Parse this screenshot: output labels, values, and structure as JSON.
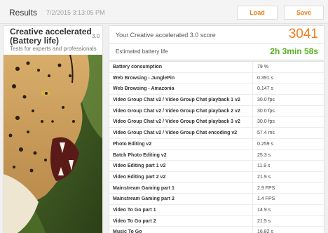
{
  "header": {
    "title": "Results",
    "date": "7/2/2015 3:13:05 PM",
    "load_label": "Load",
    "save_label": "Save"
  },
  "test": {
    "title": "Creative accelerated (Battery life)",
    "version": "3.0",
    "subtitle": "Tests for experts and professionals"
  },
  "score": {
    "label": "Your Creative accelerated 3.0 score",
    "value": "3041"
  },
  "battery": {
    "label": "Estimated battery life",
    "value": "2h 3min 58s"
  },
  "colors": {
    "accent": "#f07c1c",
    "battery_green": "#58b21e"
  },
  "rows": [
    {
      "name": "Battery consumption",
      "value": "79 %"
    },
    {
      "name": "Web Browsing - JunglePin",
      "value": "0.391 s"
    },
    {
      "name": "Web Browsing - Amazonia",
      "value": "0.147 s"
    },
    {
      "name": "Video Group Chat v2 / Video Group Chat playback 1 v2",
      "value": "30.0 fps"
    },
    {
      "name": "Video Group Chat v2 / Video Group Chat playback 2 v2",
      "value": "30.0 fps"
    },
    {
      "name": "Video Group Chat v2 / Video Group Chat playback 3 v2",
      "value": "30.0 fps"
    },
    {
      "name": "Video Group Chat v2 / Video Group Chat encoding v2",
      "value": "57.4 ms"
    },
    {
      "name": "Photo Editing v2",
      "value": "0.259 s"
    },
    {
      "name": "Batch Photo Editing v2",
      "value": "25.3 s"
    },
    {
      "name": "Video Editing part 1 v2",
      "value": "11.9 s"
    },
    {
      "name": "Video Editing part 2 v2",
      "value": "21.9 s"
    },
    {
      "name": "Mainstream Gaming part 1",
      "value": "2.9 FPS"
    },
    {
      "name": "Mainstream Gaming part 2",
      "value": "1.4 FPS"
    },
    {
      "name": "Video To Go part 1",
      "value": "14.9 s"
    },
    {
      "name": "Video To Go part 2",
      "value": "21.5 s"
    },
    {
      "name": "Music To Go",
      "value": "16.82 s"
    }
  ]
}
